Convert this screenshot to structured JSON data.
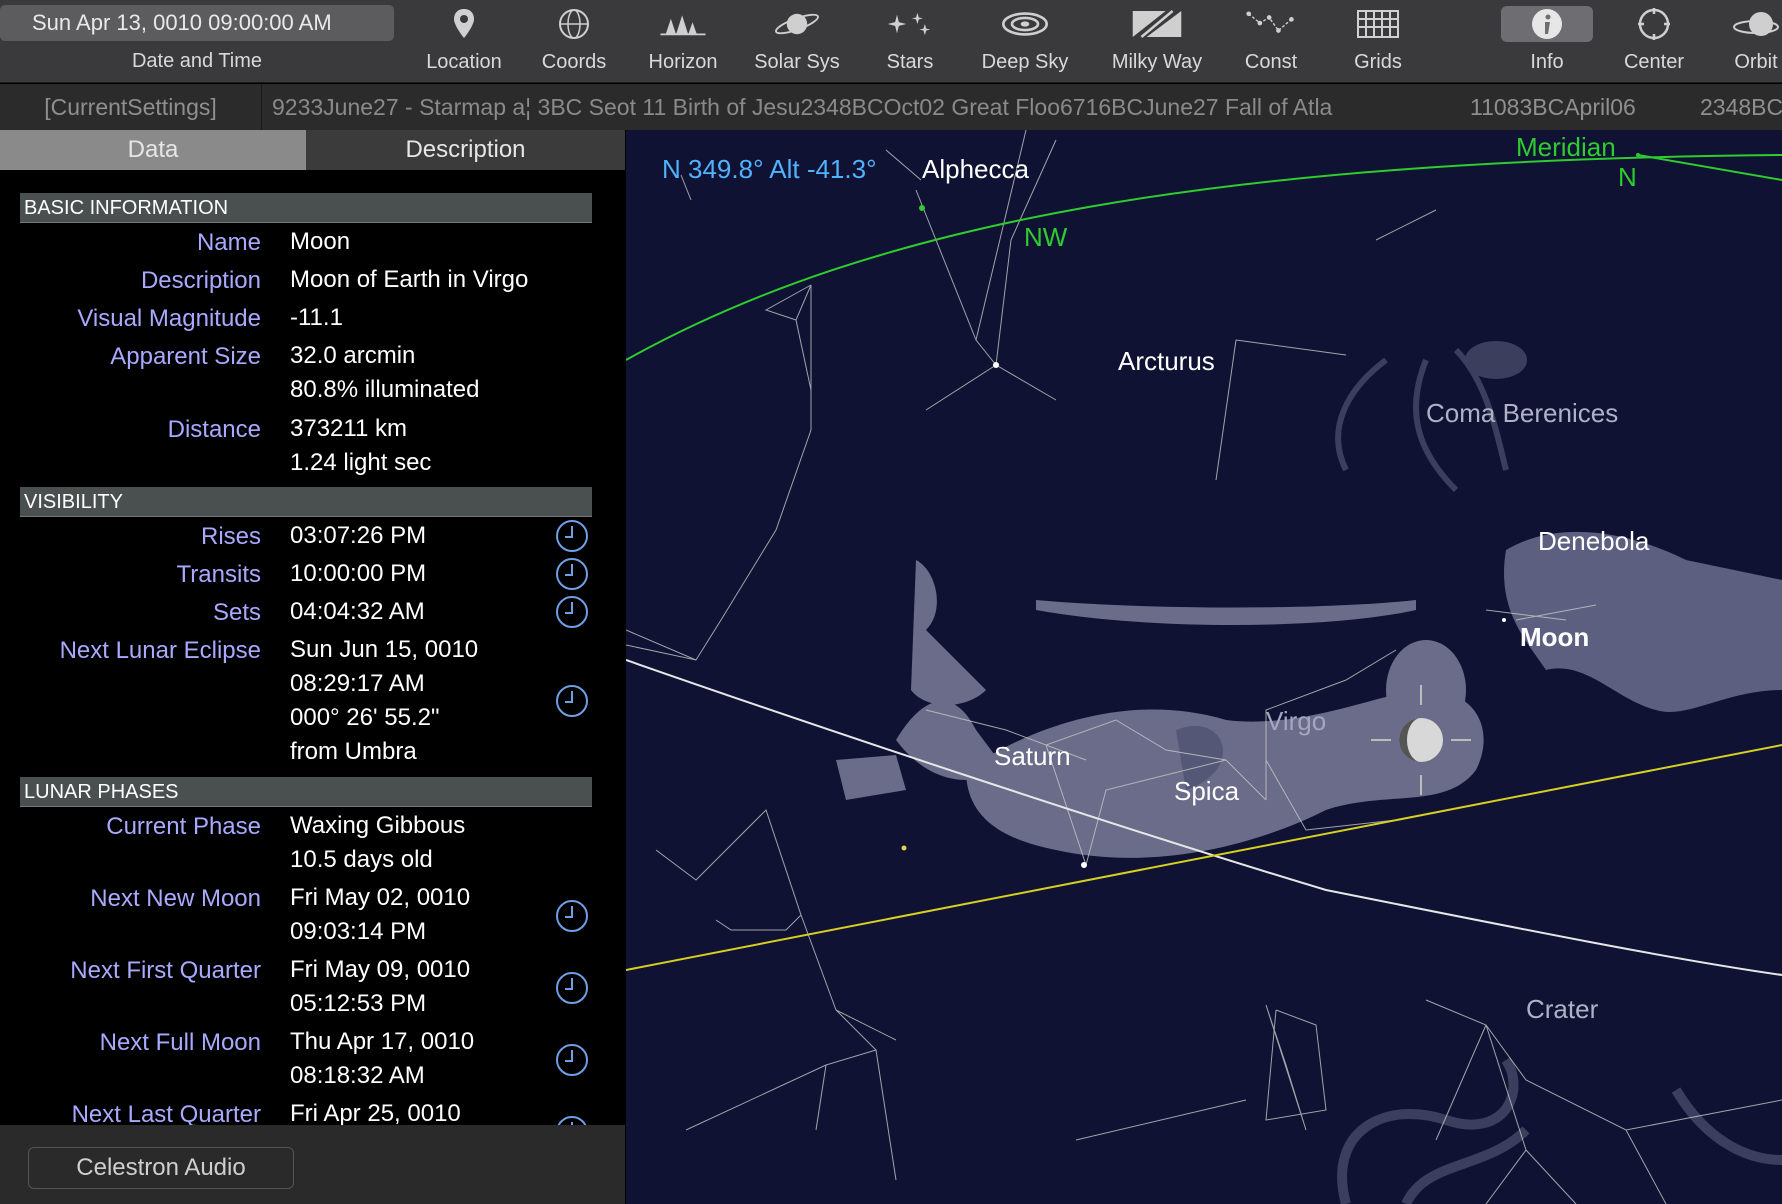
{
  "toolbar": {
    "datetime": "Sun Apr 13, 0010  09:00:00 AM",
    "datetime_label": "Date and Time",
    "buttons": [
      {
        "label": "Location",
        "icon": "location-pin-icon"
      },
      {
        "label": "Coords",
        "icon": "coords-icon"
      },
      {
        "label": "Horizon",
        "icon": "horizon-icon"
      },
      {
        "label": "Solar Sys",
        "icon": "solar-system-icon"
      },
      {
        "label": "Stars",
        "icon": "stars-icon"
      },
      {
        "label": "Deep Sky",
        "icon": "deep-sky-icon"
      },
      {
        "label": "Milky Way",
        "icon": "milky-way-icon"
      },
      {
        "label": "Const",
        "icon": "constellation-icon"
      },
      {
        "label": "Grids",
        "icon": "grid-icon"
      },
      {
        "label": "Info",
        "icon": "info-icon",
        "active": true
      },
      {
        "label": "Center",
        "icon": "center-icon"
      },
      {
        "label": "Orbit",
        "icon": "orbit-icon"
      }
    ]
  },
  "tabs": {
    "current": "[CurrentSettings]",
    "scroll_text": "9233June27 - Starmap a¦ 3BC Seot 11 Birth of Jesu2348BCOct02 Great Floo6716BCJune27 Fall of Atla",
    "right1": "11083BCApril06",
    "right2": "2348BC"
  },
  "panel": {
    "tab_data": "Data",
    "tab_description": "Description",
    "sections": {
      "basic": "BASIC INFORMATION",
      "visibility": "VISIBILITY",
      "lunar": "LUNAR PHASES"
    },
    "basic": {
      "name_label": "Name",
      "name_value": "Moon",
      "description_label": "Description",
      "description_value": "Moon of Earth in Virgo",
      "magnitude_label": "Visual Magnitude",
      "magnitude_value": "-11.1",
      "size_label": "Apparent Size",
      "size_value": "32.0 arcmin",
      "size_value2": "80.8% illuminated",
      "distance_label": "Distance",
      "distance_value": "373211 km",
      "distance_value2": "1.24 light sec"
    },
    "visibility": {
      "rises_label": "Rises",
      "rises_value": "03:07:26 PM",
      "transits_label": "Transits",
      "transits_value": "10:00:00 PM",
      "sets_label": "Sets",
      "sets_value": "04:04:32 AM",
      "eclipse_label": "Next Lunar Eclipse",
      "eclipse_value1": "Sun Jun 15, 0010",
      "eclipse_value2": "08:29:17 AM",
      "eclipse_value3": "000° 26' 55.2\"",
      "eclipse_value4": "from Umbra"
    },
    "lunar": {
      "current_label": "Current Phase",
      "current_value": "Waxing Gibbous",
      "current_value2": "10.5 days old",
      "new_label": "Next New Moon",
      "new_value": "Fri May 02, 0010",
      "new_value2": "09:03:14 PM",
      "first_label": "Next First Quarter",
      "first_value": "Fri May 09, 0010",
      "first_value2": "05:12:53 PM",
      "full_label": "Next Full Moon",
      "full_value": "Thu Apr 17, 0010",
      "full_value2": "08:18:32 AM",
      "last_label": "Next Last Quarter",
      "last_value": "Fri Apr 25, 0010"
    },
    "audio_button": "Celestron Audio"
  },
  "sky": {
    "readout": "N 349.8° Alt -41.3°",
    "labels": {
      "alphecca": "Alphecca",
      "arcturus": "Arcturus",
      "coma": "Coma Berenices",
      "denebola": "Denebola",
      "moon": "Moon",
      "virgo": "Virgo",
      "saturn": "Saturn",
      "spica": "Spica",
      "crater": "Crater",
      "nw": "NW",
      "meridian": "Meridian",
      "n": "N"
    },
    "colors": {
      "background": "#0f1232",
      "horizon": "#2ecc2e",
      "ecliptic": "#d8d020",
      "equator": "#e6e6e6",
      "readout": "#4fb3ff",
      "constellation_lines": "#c8c8c8"
    }
  }
}
